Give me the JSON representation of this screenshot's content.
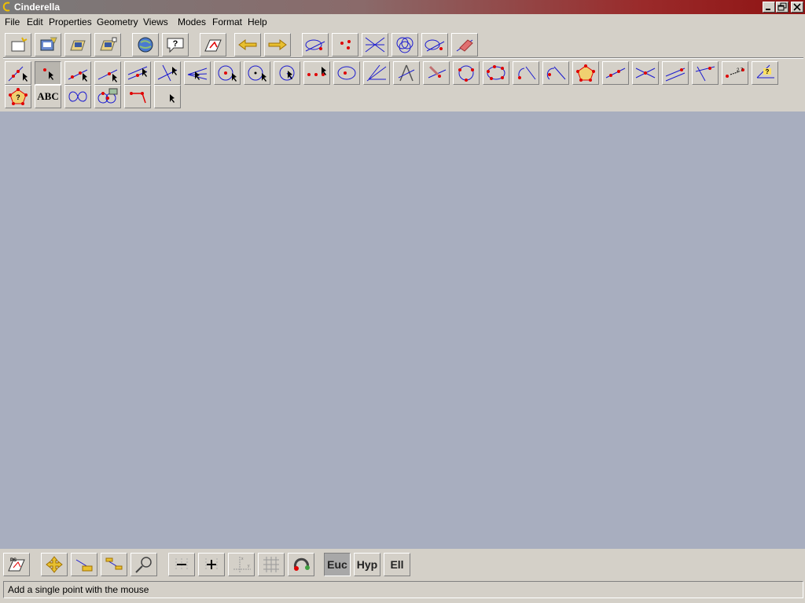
{
  "window": {
    "title": "Cinderella"
  },
  "menu": [
    "File",
    "Edit",
    "Properties",
    "Geometry",
    "Views",
    "Modes",
    "Format",
    "Help"
  ],
  "toolbar_general": [
    {
      "name": "new-file-icon"
    },
    {
      "name": "open-file-icon"
    },
    {
      "name": "save-icon"
    },
    {
      "name": "save-as-icon"
    },
    {
      "name": "export-web-icon"
    },
    {
      "name": "help-icon"
    },
    {
      "name": "print-icon"
    },
    {
      "name": "undo-icon"
    },
    {
      "name": "redo-icon"
    },
    {
      "name": "select-points-icon"
    },
    {
      "name": "select-lines-icon"
    },
    {
      "name": "select-conics-icon"
    },
    {
      "name": "select-all-icon"
    },
    {
      "name": "deselect-icon"
    },
    {
      "name": "erase-icon"
    }
  ],
  "toolbar_modes_row1": [
    "move-mode-icon",
    "add-point-icon",
    "add-line-icon",
    "add-segment-icon",
    "add-parallel-icon",
    "add-perpendicular-icon",
    "angle-bisector-icon",
    "circle-center-point-icon",
    "circle-by-radius-icon",
    "compass-icon",
    "midpoint-icon",
    "conic-icon",
    "bisector-line-icon",
    "compass-tool-icon",
    "polar-icon",
    "circle-three-points-icon",
    "conic-five-points-icon",
    "arc-icon",
    "arc-tangent-icon",
    "polygon-icon",
    "line-through-points-icon",
    "intersection-icon",
    "parallel-lines-icon",
    "perpendicular-point-icon",
    "distance-icon",
    "angle-measure-icon"
  ],
  "toolbar_modes_row2": [
    "polygon-area-icon",
    "text-icon",
    "locus-icon",
    "animation-icon",
    "segment-drag-icon",
    "select-mode-icon"
  ],
  "text_tool_label": "ABC",
  "bottom_toolbar": {
    "geometry_modes": [
      {
        "label": "Euc",
        "active": true
      },
      {
        "label": "Hyp",
        "active": false
      },
      {
        "label": "Ell",
        "active": false
      }
    ]
  },
  "status": {
    "message": "Add a single point with the mouse"
  },
  "colors": {
    "canvas": "#a8aebf",
    "chrome": "#d4d0c8",
    "accent_red": "#e00000",
    "line_blue": "#1a1ad0"
  }
}
